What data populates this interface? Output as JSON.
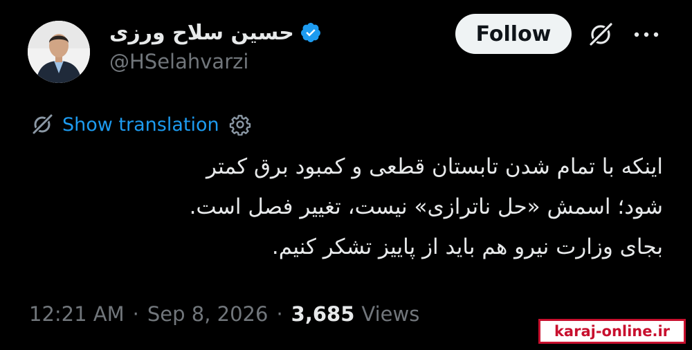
{
  "header": {
    "display_name": "حسین سلاح ورزی",
    "handle": "@HSelahvarzi",
    "follow_label": "Follow",
    "verified_color": "#1d9bf0"
  },
  "translation": {
    "label": "Show translation"
  },
  "tweet": {
    "lines": [
      "اینکه با تمام شدن تابستان قطعی و کمبود برق کمتر",
      "شود؛ اسمش «حل ناترازی» نیست، تغییر فصل است.",
      "بجای وزارت نیرو هم باید از پاییز تشکر کنیم."
    ]
  },
  "meta": {
    "time": "12:21 AM",
    "separator": "·",
    "date": "Sep 8, 2026",
    "views_count": "3,685",
    "views_label": "Views"
  },
  "watermark": {
    "text": "karaj-online.ir",
    "color": "#c8102e"
  },
  "icons": {
    "grok": "grok-icon",
    "more": "more-icon",
    "translate": "translate-icon",
    "settings": "settings-icon",
    "verified": "verified-badge-icon"
  }
}
